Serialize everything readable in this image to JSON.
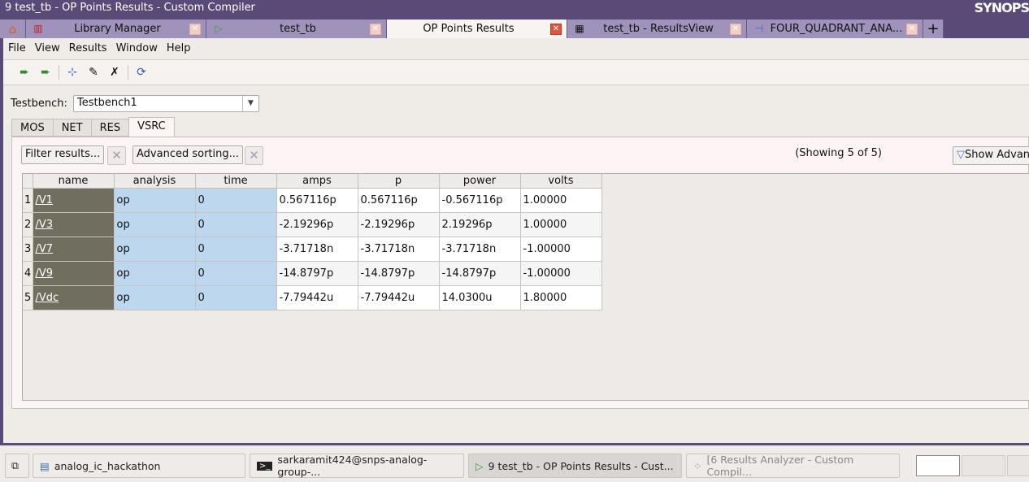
{
  "window": {
    "title": "9 test_tb - OP Points Results - Custom Compiler",
    "brand": "SYNOPS"
  },
  "tabs": [
    {
      "label": "Library Manager",
      "icon": "library-icon"
    },
    {
      "label": "test_tb",
      "icon": "schematic-icon"
    },
    {
      "label": "OP Points Results",
      "icon": "none",
      "active": true
    },
    {
      "label": "test_tb - ResultsView",
      "icon": "table-icon"
    },
    {
      "label": "FOUR_QUADRANT_ANA...",
      "icon": "mosfet-icon"
    }
  ],
  "menu": [
    "File",
    "View",
    "Results",
    "Window",
    "Help"
  ],
  "testbench": {
    "label": "Testbench:",
    "value": "Testbench1"
  },
  "subtabs": [
    "MOS",
    "NET",
    "RES",
    "VSRC"
  ],
  "active_subtab": "VSRC",
  "filter": {
    "filter_label": "Filter results...",
    "sort_label": "Advanced sorting...",
    "showing": "(Showing 5 of 5)",
    "show_advanced": "Show Advan"
  },
  "table": {
    "columns": [
      "name",
      "analysis",
      "time",
      "amps",
      "p",
      "power",
      "volts"
    ],
    "rows": [
      [
        "1",
        "/V1",
        "op",
        "0",
        "0.567116p",
        "0.567116p",
        "-0.567116p",
        "1.00000"
      ],
      [
        "2",
        "/V3",
        "op",
        "0",
        "-2.19296p",
        "-2.19296p",
        "2.19296p",
        "1.00000"
      ],
      [
        "3",
        "/V7",
        "op",
        "0",
        "-3.71718n",
        "-3.71718n",
        "-3.71718n",
        "-1.00000"
      ],
      [
        "4",
        "/V9",
        "op",
        "0",
        "-14.8797p",
        "-14.8797p",
        "-14.8797p",
        "-1.00000"
      ],
      [
        "5",
        "/Vdc",
        "op",
        "0",
        "-7.79442u",
        "-7.79442u",
        "14.0300u",
        "1.80000"
      ]
    ]
  },
  "taskbar": [
    {
      "label": "analog_ic_hackathon"
    },
    {
      "label": "sarkaramit424@snps-analog-group-..."
    },
    {
      "label": "9 test_tb - OP Points Results - Cust..."
    },
    {
      "label": "[6 Results Analyzer - Custom Compil..."
    }
  ],
  "colors": {
    "titlebar": "#5a4a78",
    "tab_inactive": "#a093bb",
    "name_cell": "#706e5e",
    "highlight_cell": "#bdd7ee"
  }
}
